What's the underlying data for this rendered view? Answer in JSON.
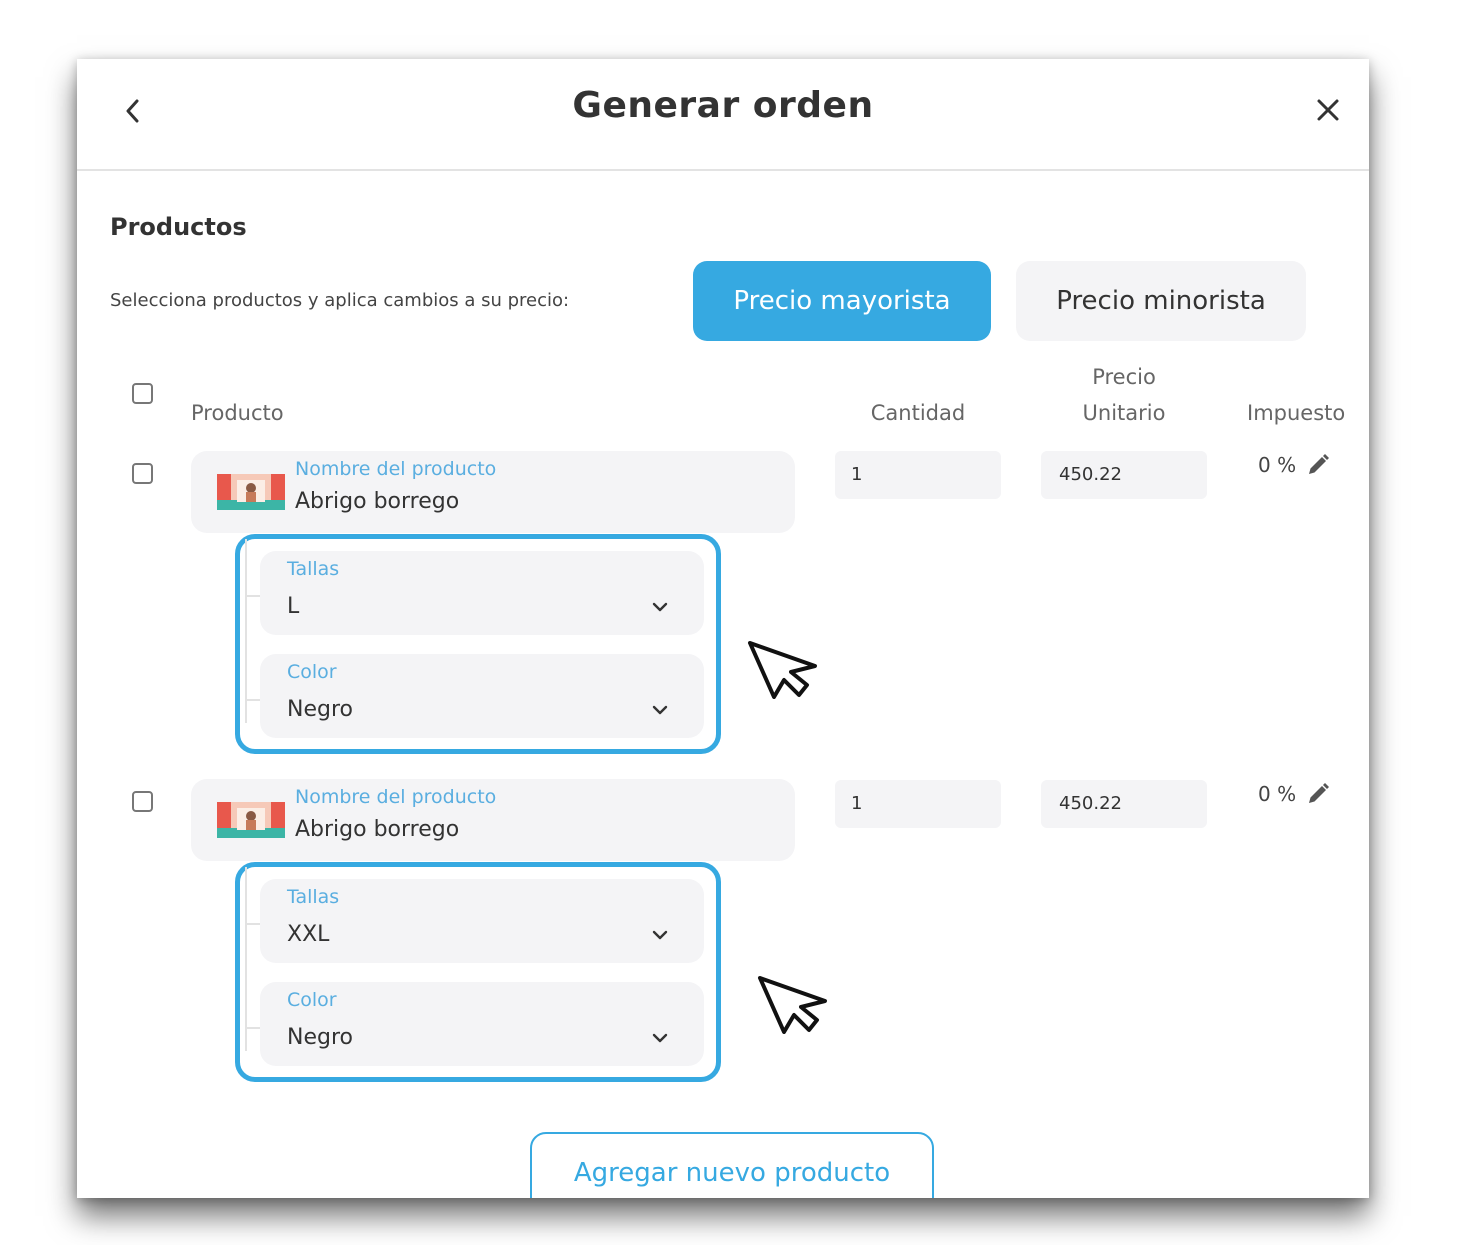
{
  "modal": {
    "title": "Generar orden"
  },
  "products_section": {
    "title": "Productos",
    "instruction": "Selecciona productos y aplica cambios a su precio:",
    "wholesale_button": "Precio mayorista",
    "retail_button": "Precio minorista"
  },
  "table": {
    "headers": {
      "product": "Producto",
      "quantity": "Cantidad",
      "unit_price_line1": "Precio",
      "unit_price_line2": "Unitario",
      "tax": "Impuesto"
    },
    "rows": [
      {
        "product_label": "Nombre del producto",
        "product_name": "Abrigo borrego",
        "quantity": "1",
        "unit_price": "450.22",
        "tax": "0 %",
        "variants": [
          {
            "label": "Tallas",
            "value": "L"
          },
          {
            "label": "Color",
            "value": "Negro"
          }
        ]
      },
      {
        "product_label": "Nombre del producto",
        "product_name": "Abrigo borrego",
        "quantity": "1",
        "unit_price": "450.22",
        "tax": "0 %",
        "variants": [
          {
            "label": "Tallas",
            "value": "XXL"
          },
          {
            "label": "Color",
            "value": "Negro"
          }
        ]
      }
    ]
  },
  "add_product_button": "Agregar nuevo producto",
  "colors": {
    "accent": "#36a9e1",
    "field_background": "#f4f4f6",
    "label_blue": "#5aaee0"
  },
  "icons": [
    "chevron-left-icon",
    "close-icon",
    "pencil-icon",
    "chevron-down-icon",
    "mouse-cursor-icon",
    "product-thumbnail"
  ]
}
